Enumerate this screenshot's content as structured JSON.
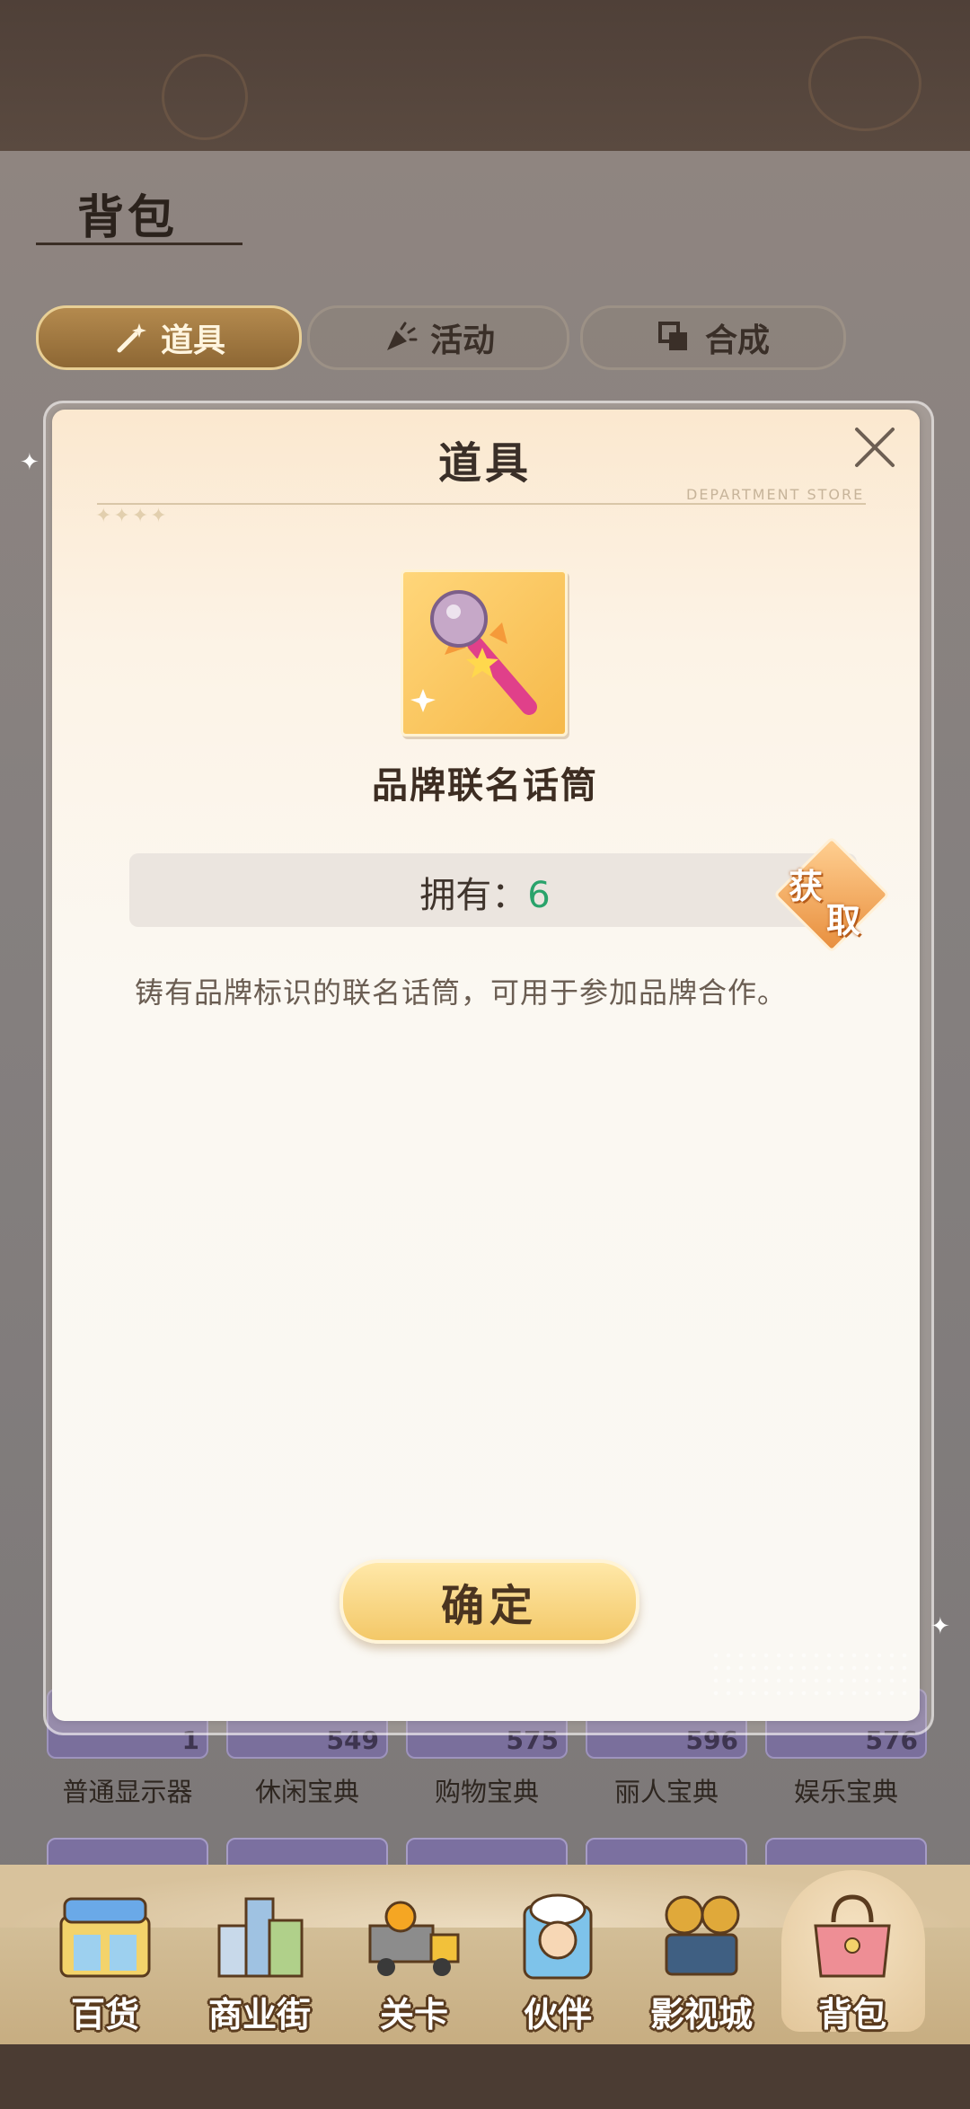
{
  "page": {
    "title": "背包",
    "tabs": [
      {
        "label": "道具",
        "icon": "magic-wand-icon",
        "active": true
      },
      {
        "label": "活动",
        "icon": "party-popper-icon",
        "active": false
      },
      {
        "label": "合成",
        "icon": "merge-squares-icon",
        "active": false
      }
    ]
  },
  "grid": {
    "items": [
      {
        "label": "普通显示器",
        "count": "1"
      },
      {
        "label": "休闲宝典",
        "count": "549"
      },
      {
        "label": "购物宝典",
        "count": "575"
      },
      {
        "label": "丽人宝典",
        "count": "596"
      },
      {
        "label": "娱乐宝典",
        "count": "576"
      }
    ]
  },
  "modal": {
    "title": "道具",
    "subtitle_deco": "DEPARTMENT STORE",
    "item_icon": "microphone-icon",
    "item_name": "品牌联名话筒",
    "own_label": "拥有：",
    "own_value": "6",
    "get_badge": {
      "line1": "获",
      "line2": "取"
    },
    "description": "铸有品牌标识的联名话筒，可用于参加品牌合作。",
    "confirm_label": "确定"
  },
  "bottom_nav": [
    {
      "label": "百货",
      "icon": "department-store-icon"
    },
    {
      "label": "商业街",
      "icon": "city-street-icon"
    },
    {
      "label": "关卡",
      "icon": "truck-icon"
    },
    {
      "label": "伙伴",
      "icon": "chef-partner-icon"
    },
    {
      "label": "影视城",
      "icon": "film-camera-icon"
    },
    {
      "label": "背包",
      "icon": "handbag-icon",
      "active": true
    }
  ],
  "colors": {
    "accent_green": "#2aa36b",
    "tab_active": "#a07a40",
    "button_gold": "#f3c868"
  }
}
